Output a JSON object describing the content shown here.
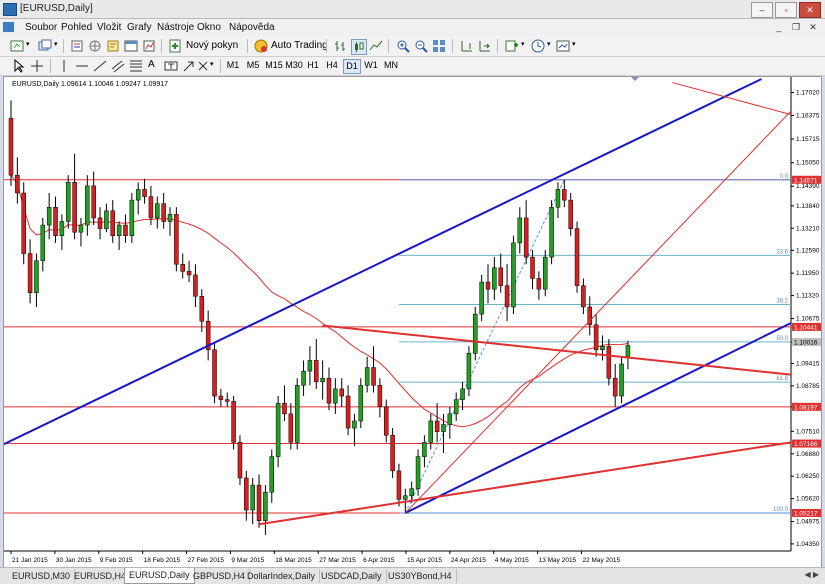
{
  "window": {
    "title": "[EURUSD,Daily]"
  },
  "menu": [
    "Soubor",
    "Pohled",
    "Vložit",
    "Grafy",
    "Nástroje",
    "Okno",
    "Nápověda"
  ],
  "toolbar": {
    "new_order": "Nový pokyn",
    "auto_trading": "Auto Trading"
  },
  "timeframes": [
    "M1",
    "M5",
    "M15",
    "M30",
    "H1",
    "H4",
    "D1",
    "W1",
    "MN"
  ],
  "active_timeframe": "D1",
  "chart_header": "EURUSD,Daily  1.09614 1.10046 1.09247 1.09917",
  "price_axis": {
    "labels": [
      "1.17020",
      "1.16375",
      "1.15715",
      "1.15050",
      "1.14390",
      "1.13840",
      "1.13210",
      "1.12590",
      "1.11950",
      "1.11320",
      "1.10675",
      "1.10016",
      "1.09415",
      "1.08785",
      "1.08197",
      "1.07510",
      "1.06880",
      "1.06250",
      "1.05620",
      "1.04975",
      "1.04350"
    ],
    "values": [
      1.1702,
      1.16375,
      1.15715,
      1.1505,
      1.1439,
      1.1384,
      1.1321,
      1.1259,
      1.1195,
      1.1132,
      1.10675,
      1.10016,
      1.09415,
      1.08785,
      1.08197,
      1.0751,
      1.0688,
      1.0625,
      1.0562,
      1.04975,
      1.0435
    ],
    "badges": [
      {
        "label": "1.14571",
        "value": 1.14571,
        "color": "#e03030"
      },
      {
        "label": "1.10441",
        "value": 1.10441,
        "color": "#e03030"
      },
      {
        "label": "1.10016",
        "value": 1.10016,
        "color": "#c0c0c0"
      },
      {
        "label": "1.08197",
        "value": 1.08197,
        "color": "#e03030"
      },
      {
        "label": "1.07166",
        "value": 1.07166,
        "color": "#e03030"
      },
      {
        "label": "1.05217",
        "value": 1.05217,
        "color": "#e03030"
      }
    ]
  },
  "date_axis": {
    "labels": [
      "21 Jan 2015",
      "30 Jan 2015",
      "9 Feb 2015",
      "18 Feb 2015",
      "27 Feb 2015",
      "9 Mar 2015",
      "18 Mar 2015",
      "27 Mar 2015",
      "6 Apr 2015",
      "15 Apr 2015",
      "24 Apr 2015",
      "4 May 2015",
      "13 May 2015",
      "22 May 2015"
    ]
  },
  "fibonacci": [
    {
      "label": "0.0",
      "value": 1.14571
    },
    {
      "label": "23.6",
      "value": 1.1245
    },
    {
      "label": "38.2",
      "value": 1.1107
    },
    {
      "label": "50.0",
      "value": 1.1002
    },
    {
      "label": "61.8",
      "value": 1.0889
    },
    {
      "label": "100.0",
      "value": 1.05217
    }
  ],
  "horizontal_levels": [
    1.14571,
    1.10441,
    1.08197,
    1.07166,
    1.05217
  ],
  "tabs": [
    "EURUSD,M30",
    "EURUSD,H4",
    "EURUSD,Daily",
    "GBPUSD,H4",
    "DollarIndex,Daily",
    "USDCAD,Daily",
    "US30YBond,H4"
  ],
  "active_tab": "EURUSD,Daily",
  "chart_data": {
    "type": "candlestick",
    "symbol": "EURUSD",
    "timeframe": "Daily",
    "ylim": [
      1.0415,
      1.174
    ],
    "candles": [
      [
        1.163,
        1.168,
        1.144,
        1.147
      ],
      [
        1.147,
        1.152,
        1.139,
        1.142
      ],
      [
        1.142,
        1.145,
        1.122,
        1.125
      ],
      [
        1.125,
        1.129,
        1.111,
        1.114
      ],
      [
        1.114,
        1.125,
        1.11,
        1.123
      ],
      [
        1.123,
        1.135,
        1.12,
        1.133
      ],
      [
        1.133,
        1.142,
        1.129,
        1.138
      ],
      [
        1.138,
        1.141,
        1.128,
        1.13
      ],
      [
        1.13,
        1.136,
        1.126,
        1.134
      ],
      [
        1.134,
        1.147,
        1.132,
        1.145
      ],
      [
        1.145,
        1.153,
        1.129,
        1.131
      ],
      [
        1.131,
        1.135,
        1.127,
        1.133
      ],
      [
        1.133,
        1.147,
        1.13,
        1.144
      ],
      [
        1.144,
        1.148,
        1.133,
        1.135
      ],
      [
        1.135,
        1.138,
        1.129,
        1.132
      ],
      [
        1.132,
        1.139,
        1.131,
        1.137
      ],
      [
        1.137,
        1.14,
        1.128,
        1.13
      ],
      [
        1.13,
        1.134,
        1.126,
        1.133
      ],
      [
        1.133,
        1.136,
        1.128,
        1.13
      ],
      [
        1.13,
        1.142,
        1.128,
        1.14
      ],
      [
        1.14,
        1.145,
        1.136,
        1.143
      ],
      [
        1.143,
        1.146,
        1.139,
        1.141
      ],
      [
        1.141,
        1.144,
        1.133,
        1.135
      ],
      [
        1.135,
        1.141,
        1.132,
        1.139
      ],
      [
        1.139,
        1.142,
        1.132,
        1.134
      ],
      [
        1.134,
        1.138,
        1.13,
        1.136
      ],
      [
        1.136,
        1.138,
        1.12,
        1.122
      ],
      [
        1.122,
        1.125,
        1.118,
        1.12
      ],
      [
        1.12,
        1.123,
        1.117,
        1.119
      ],
      [
        1.119,
        1.122,
        1.11,
        1.113
      ],
      [
        1.113,
        1.115,
        1.103,
        1.106
      ],
      [
        1.106,
        1.109,
        1.095,
        1.098
      ],
      [
        1.098,
        1.1,
        1.083,
        1.085
      ],
      [
        1.085,
        1.087,
        1.082,
        1.084
      ],
      [
        1.084,
        1.086,
        1.082,
        1.0835
      ],
      [
        1.0835,
        1.085,
        1.07,
        1.072
      ],
      [
        1.072,
        1.074,
        1.06,
        1.062
      ],
      [
        1.062,
        1.064,
        1.05,
        1.053
      ],
      [
        1.053,
        1.062,
        1.049,
        1.06
      ],
      [
        1.06,
        1.063,
        1.048,
        1.05
      ],
      [
        1.05,
        1.06,
        1.046,
        1.058
      ],
      [
        1.058,
        1.07,
        1.055,
        1.068
      ],
      [
        1.068,
        1.085,
        1.065,
        1.083
      ],
      [
        1.083,
        1.088,
        1.078,
        1.08
      ],
      [
        1.08,
        1.083,
        1.07,
        1.072
      ],
      [
        1.072,
        1.09,
        1.07,
        1.088
      ],
      [
        1.088,
        1.095,
        1.085,
        1.092
      ],
      [
        1.092,
        1.099,
        1.088,
        1.095
      ],
      [
        1.095,
        1.101,
        1.087,
        1.089
      ],
      [
        1.089,
        1.095,
        1.084,
        1.09
      ],
      [
        1.09,
        1.093,
        1.081,
        1.083
      ],
      [
        1.083,
        1.09,
        1.08,
        1.087
      ],
      [
        1.087,
        1.09,
        1.082,
        1.085
      ],
      [
        1.085,
        1.088,
        1.074,
        1.076
      ],
      [
        1.076,
        1.08,
        1.071,
        1.078
      ],
      [
        1.078,
        1.09,
        1.076,
        1.088
      ],
      [
        1.088,
        1.096,
        1.086,
        1.093
      ],
      [
        1.093,
        1.099,
        1.086,
        1.088
      ],
      [
        1.088,
        1.09,
        1.079,
        1.082
      ],
      [
        1.082,
        1.084,
        1.072,
        1.074
      ],
      [
        1.074,
        1.076,
        1.062,
        1.064
      ],
      [
        1.064,
        1.066,
        1.054,
        1.056
      ],
      [
        1.056,
        1.059,
        1.052,
        1.057
      ],
      [
        1.057,
        1.061,
        1.055,
        1.059
      ],
      [
        1.059,
        1.07,
        1.057,
        1.068
      ],
      [
        1.068,
        1.074,
        1.065,
        1.072
      ],
      [
        1.072,
        1.08,
        1.07,
        1.078
      ],
      [
        1.078,
        1.083,
        1.072,
        1.075
      ],
      [
        1.075,
        1.08,
        1.069,
        1.077
      ],
      [
        1.077,
        1.082,
        1.073,
        1.08
      ],
      [
        1.08,
        1.086,
        1.078,
        1.084
      ],
      [
        1.084,
        1.089,
        1.081,
        1.087
      ],
      [
        1.087,
        1.099,
        1.085,
        1.097
      ],
      [
        1.097,
        1.11,
        1.095,
        1.108
      ],
      [
        1.108,
        1.119,
        1.106,
        1.117
      ],
      [
        1.117,
        1.122,
        1.111,
        1.115
      ],
      [
        1.115,
        1.124,
        1.112,
        1.121
      ],
      [
        1.121,
        1.125,
        1.114,
        1.116
      ],
      [
        1.116,
        1.122,
        1.106,
        1.11
      ],
      [
        1.11,
        1.13,
        1.108,
        1.128
      ],
      [
        1.128,
        1.138,
        1.125,
        1.135
      ],
      [
        1.135,
        1.14,
        1.122,
        1.124
      ],
      [
        1.124,
        1.126,
        1.115,
        1.118
      ],
      [
        1.118,
        1.12,
        1.112,
        1.115
      ],
      [
        1.115,
        1.126,
        1.113,
        1.124
      ],
      [
        1.124,
        1.14,
        1.122,
        1.138
      ],
      [
        1.138,
        1.145,
        1.135,
        1.143
      ],
      [
        1.143,
        1.1457,
        1.138,
        1.14
      ],
      [
        1.14,
        1.142,
        1.13,
        1.132
      ],
      [
        1.132,
        1.134,
        1.114,
        1.116
      ],
      [
        1.116,
        1.118,
        1.108,
        1.11
      ],
      [
        1.11,
        1.113,
        1.102,
        1.105
      ],
      [
        1.105,
        1.108,
        1.096,
        1.098
      ],
      [
        1.098,
        1.102,
        1.095,
        1.099
      ],
      [
        1.099,
        1.101,
        1.088,
        1.09
      ],
      [
        1.09,
        1.094,
        1.082,
        1.085
      ],
      [
        1.085,
        1.096,
        1.083,
        1.094
      ],
      [
        1.0961,
        1.1005,
        1.0925,
        1.0992
      ]
    ]
  }
}
